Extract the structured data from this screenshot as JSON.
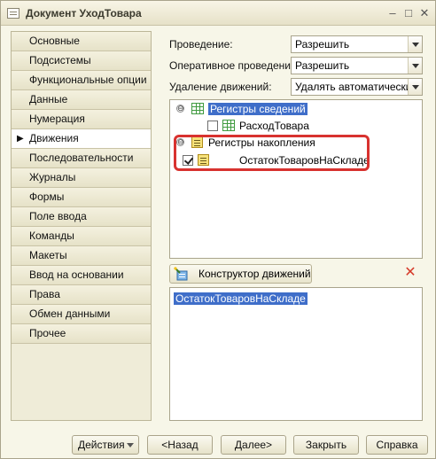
{
  "window": {
    "title": "Документ УходТовара"
  },
  "tabs": [
    {
      "label": "Основные"
    },
    {
      "label": "Подсистемы"
    },
    {
      "label": "Функциональные опции"
    },
    {
      "label": "Данные"
    },
    {
      "label": "Нумерация"
    },
    {
      "label": "Движения",
      "active": true
    },
    {
      "label": "Последовательности"
    },
    {
      "label": "Журналы"
    },
    {
      "label": "Формы"
    },
    {
      "label": "Поле ввода"
    },
    {
      "label": "Команды"
    },
    {
      "label": "Макеты"
    },
    {
      "label": "Ввод на основании"
    },
    {
      "label": "Права"
    },
    {
      "label": "Обмен данными"
    },
    {
      "label": "Прочее"
    }
  ],
  "fields": {
    "posting": {
      "label": "Проведение:",
      "value": "Разрешить"
    },
    "realtime_posting": {
      "label": "Оперативное проведение:",
      "value": "Разрешить"
    },
    "movement_deletion": {
      "label": "Удаление движений:",
      "value": "Удалять автоматически п"
    }
  },
  "tree": {
    "info_registers": {
      "label": "Регистры сведений",
      "expander": "⊖"
    },
    "info_child": {
      "label": "РасходТовара",
      "checked": false
    },
    "accum_registers": {
      "label": "Регистры накопления",
      "expander": "⊖"
    },
    "accum_child": {
      "label": "ОстатокТоваровНаСкладе",
      "checked": true
    }
  },
  "constructor_button": {
    "label": "Конструктор движений"
  },
  "delete_icon": "close-icon",
  "selected_list": [
    "ОстатокТоваровНаСкладе"
  ],
  "buttons": {
    "actions": "Действия",
    "back": "<Назад",
    "next": "Далее>",
    "close": "Закрыть",
    "help": "Справка"
  },
  "colors": {
    "highlight_border": "#d8322f",
    "selection": "#3f6ec9",
    "window_bg": "#f7f6e8"
  }
}
